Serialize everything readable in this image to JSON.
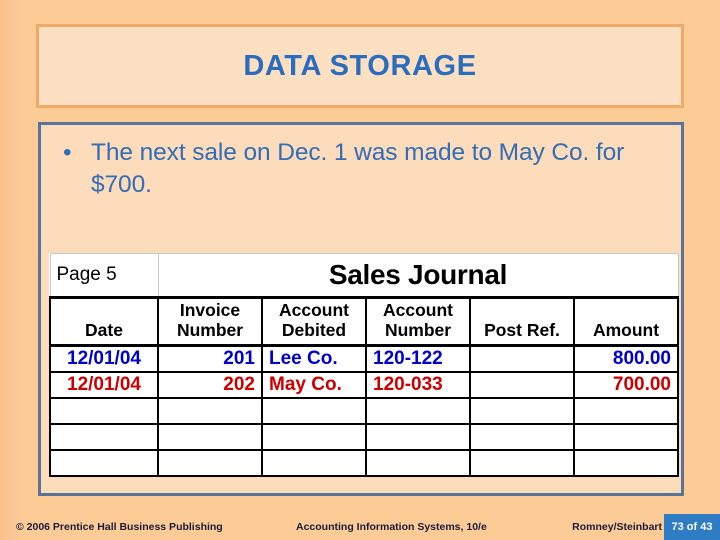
{
  "slide": {
    "title": "DATA STORAGE",
    "colors": {
      "background": "#fccb96",
      "content_background": "#fcdcbb",
      "content_border": "#5a7398",
      "title_border": "#f2a967",
      "title_text": "#2a6cbe",
      "bullet_text": "#336cb7",
      "row_blue": "#0000cc",
      "row_red": "#cc0000",
      "footer_badge": "#2e7cc4"
    }
  },
  "content": {
    "bullets": [
      {
        "marker": "•",
        "text": "The next sale on Dec. 1 was made to May Co. for $700."
      }
    ]
  },
  "journal": {
    "page_label": "Page 5",
    "title": "Sales Journal",
    "columns": [
      {
        "line1": "",
        "line2": "Date"
      },
      {
        "line1": "Invoice",
        "line2": "Number"
      },
      {
        "line1": "Account",
        "line2": "Debited"
      },
      {
        "line1": "Account",
        "line2": "Number"
      },
      {
        "line1": "",
        "line2": "Post Ref."
      },
      {
        "line1": "",
        "line2": "Amount"
      }
    ],
    "rows": [
      {
        "color": "#0000cc",
        "date": "12/01/04",
        "invoice_number": "201",
        "account_debited": "Lee Co.",
        "account_number": "120-122",
        "post_ref": "",
        "amount": "800.00"
      },
      {
        "color": "#cc0000",
        "date": "12/01/04",
        "invoice_number": "202",
        "account_debited": "May Co.",
        "account_number": "120-033",
        "post_ref": "",
        "amount": "700.00"
      }
    ],
    "empty_row_count": 3
  },
  "footer": {
    "left": "© 2006 Prentice Hall Business Publishing",
    "center": "Accounting Information Systems, 10/e",
    "right": "Romney/Steinbart",
    "page": "73 of 43"
  }
}
